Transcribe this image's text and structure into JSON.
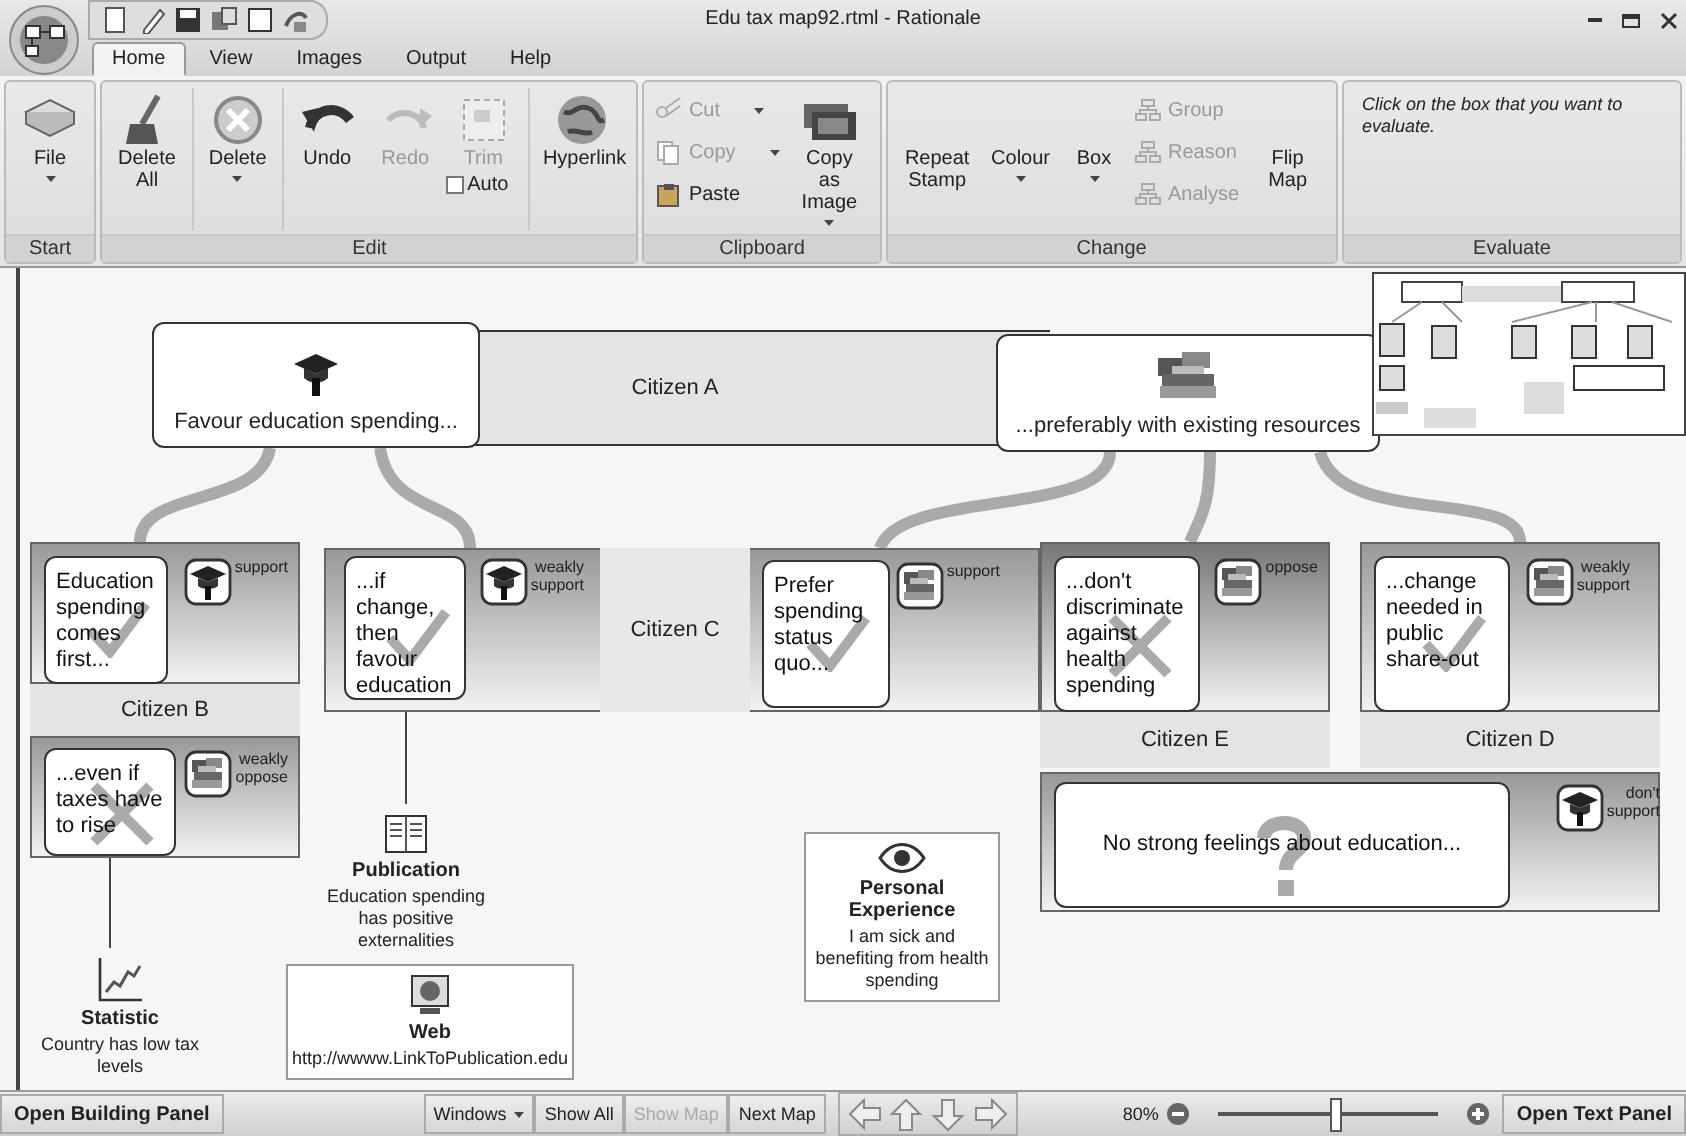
{
  "window": {
    "title": "Edu tax map92.rtml - Rationale"
  },
  "tabs": [
    {
      "label": "Home",
      "selected": true
    },
    {
      "label": "View",
      "selected": false
    },
    {
      "label": "Images",
      "selected": false
    },
    {
      "label": "Output",
      "selected": false
    },
    {
      "label": "Help",
      "selected": false
    }
  ],
  "ribbon": {
    "groups": [
      {
        "label": "Start",
        "buttons": [
          {
            "kind": "large",
            "label": "File",
            "dropdown": true,
            "disabled": false
          }
        ]
      },
      {
        "label": "Edit",
        "buttons": [
          {
            "kind": "large",
            "label": "Delete All",
            "dropdown": false,
            "disabled": false
          },
          {
            "kind": "large",
            "label": "Delete",
            "dropdown": true,
            "disabled": false
          },
          {
            "kind": "large",
            "label": "Undo",
            "dropdown": false,
            "disabled": false
          },
          {
            "kind": "large",
            "label": "Redo",
            "dropdown": false,
            "disabled": true
          },
          {
            "kind": "large",
            "label": "Trim",
            "dropdown": false,
            "disabled": true
          },
          {
            "kind": "checkbox",
            "label": "Auto",
            "checked": false
          },
          {
            "kind": "large",
            "label": "Hyperlink",
            "dropdown": false,
            "disabled": false
          }
        ]
      },
      {
        "label": "Clipboard",
        "buttons": [
          {
            "kind": "small",
            "label": "Cut",
            "dropdown": true,
            "disabled": true
          },
          {
            "kind": "small",
            "label": "Copy",
            "dropdown": true,
            "disabled": true
          },
          {
            "kind": "small",
            "label": "Paste",
            "dropdown": false,
            "disabled": false
          },
          {
            "kind": "large",
            "label": "Copy as Image",
            "dropdown": true,
            "disabled": false
          }
        ]
      },
      {
        "label": "Change",
        "buttons": [
          {
            "kind": "large",
            "label": "Repeat Stamp",
            "dropdown": false,
            "disabled": false
          },
          {
            "kind": "large",
            "label": "Colour",
            "dropdown": true,
            "disabled": false
          },
          {
            "kind": "large",
            "label": "Box",
            "dropdown": true,
            "disabled": false
          },
          {
            "kind": "small",
            "label": "Group",
            "dropdown": false,
            "disabled": true
          },
          {
            "kind": "small",
            "label": "Reason",
            "dropdown": false,
            "disabled": true
          },
          {
            "kind": "small",
            "label": "Analyse",
            "dropdown": false,
            "disabled": true
          },
          {
            "kind": "large",
            "label": "Flip Map",
            "dropdown": false,
            "disabled": false
          }
        ]
      },
      {
        "label": "Evaluate",
        "hint": "Click on the box that you want to evaluate."
      }
    ]
  },
  "map": {
    "claim_owner": "Citizen A",
    "claims": [
      {
        "text": "Favour education spending..."
      },
      {
        "text": "...preferably with existing resources"
      }
    ],
    "groups": [
      {
        "owner": "Citizen B",
        "reasons": [
          {
            "kind": "tick",
            "text": "Education spending comes first...",
            "evaluation": "support"
          },
          {
            "kind": "cross",
            "text": "...even if taxes have to rise",
            "evaluation": "weakly oppose"
          }
        ]
      },
      {
        "owner": "Citizen C",
        "reasons": [
          {
            "kind": "tick",
            "text": "...if change, then favour education",
            "evaluation": "weakly support"
          },
          {
            "kind": "tick",
            "text": "Prefer spending status quo...",
            "evaluation": "support"
          }
        ]
      },
      {
        "owner": "Citizen E",
        "reasons": [
          {
            "kind": "cross",
            "text": "...don't discriminate against health spending",
            "evaluation": "oppose"
          }
        ]
      },
      {
        "owner": "Citizen D",
        "reasons": [
          {
            "kind": "tick",
            "text": "...change needed in public share-out",
            "evaluation": "weakly support"
          }
        ]
      },
      {
        "reasons": [
          {
            "kind": "question",
            "text": "No strong feelings about education...",
            "evaluation": "don't support"
          }
        ]
      }
    ],
    "evidence": [
      {
        "kind": "publication",
        "title": "Publication",
        "text": "Education spending has positive externalities"
      },
      {
        "kind": "personal",
        "title": "Personal Experience",
        "text": "I am sick and benefiting from health spending"
      },
      {
        "kind": "statistic",
        "title": "Statistic",
        "text": "Country has low tax levels"
      },
      {
        "kind": "web",
        "title": "Web",
        "text": "http://wwww.LinkToPublication.edu"
      }
    ]
  },
  "status_bar": {
    "left_button": "Open Building Panel",
    "nav": [
      {
        "label": "Windows",
        "dropdown": true,
        "disabled": false
      },
      {
        "label": "Show All",
        "dropdown": false,
        "disabled": false
      },
      {
        "label": "Show Map",
        "dropdown": false,
        "disabled": true
      },
      {
        "label": "Next Map",
        "dropdown": false,
        "disabled": false
      }
    ],
    "zoom": {
      "reading": "80%",
      "level": 0.53
    },
    "right_button": "Open Text Panel"
  }
}
